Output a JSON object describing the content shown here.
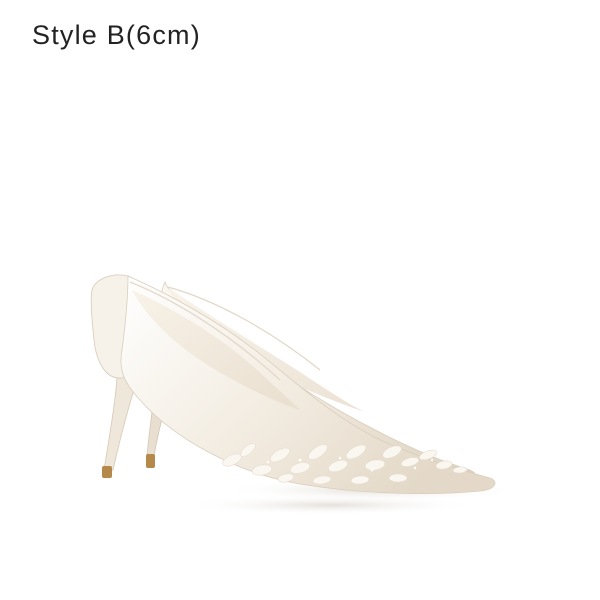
{
  "product": {
    "caption": "Style B(6cm)"
  },
  "photo": {
    "subject": "white-satin-pointed-toe-pumps-pair",
    "colors": {
      "background": "#ffffff",
      "satin": "#f3ede3",
      "satin_shadow": "#d9cfbf",
      "lining": "#f6efe4",
      "heel_tip": "#b5894a",
      "embellishment": "#faf7f1"
    }
  }
}
